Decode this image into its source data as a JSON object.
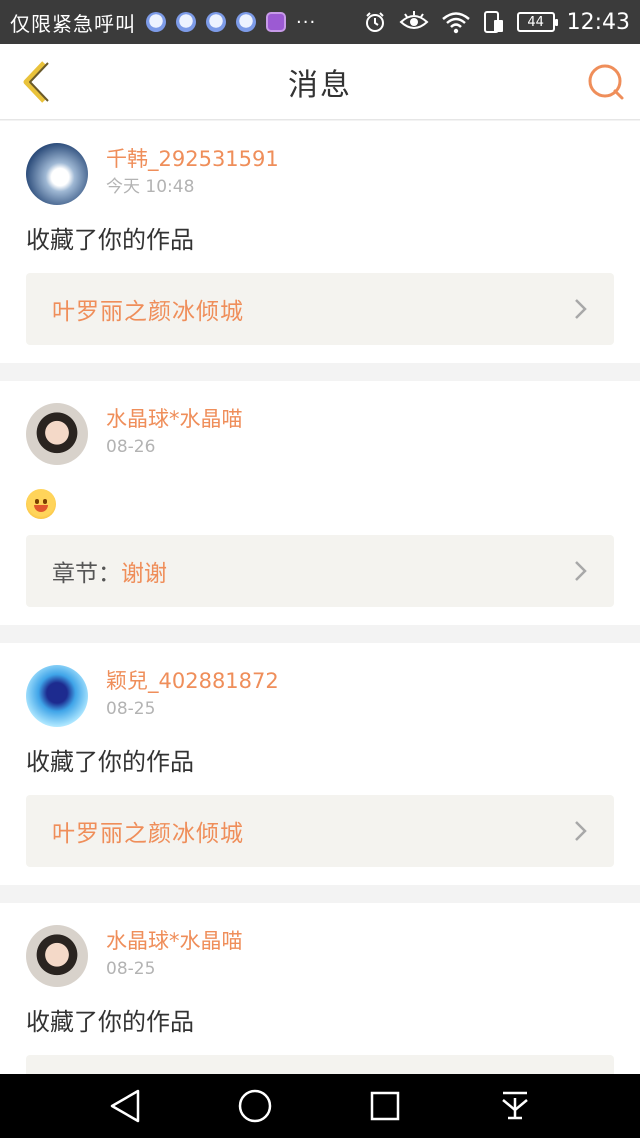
{
  "status_bar": {
    "carrier": "仅限紧急呼叫",
    "more": "···",
    "battery": "44",
    "time": "12:43",
    "icons": [
      "bear-notification-icon",
      "bear-notification-icon",
      "bear-notification-icon",
      "bear-notification-icon",
      "gallery-icon",
      "alarm-icon",
      "eye-icon",
      "wifi-icon",
      "sim-icon",
      "battery-icon"
    ]
  },
  "header": {
    "title": "消息",
    "back_icon": "chevron-left-icon",
    "search_icon": "search-icon"
  },
  "messages": [
    {
      "username": "千韩_292531591",
      "time": "今天 10:48",
      "text": "收藏了你的作品",
      "reference": "叶罗丽之颜冰倾城"
    },
    {
      "username": "水晶球*水晶喵",
      "time": "08-26",
      "emoji": "smile-emoji",
      "reference_label": "章节：",
      "reference_value": "谢谢"
    },
    {
      "username": "颖兒_402881872",
      "time": "08-25",
      "text": "收藏了你的作品",
      "reference": "叶罗丽之颜冰倾城"
    },
    {
      "username": "水晶球*水晶喵",
      "time": "08-25",
      "text": "收藏了你的作品"
    }
  ],
  "colors": {
    "accent": "#ef8e5a",
    "status_bar": "#3b3b3b",
    "card_bg": "#ffffff",
    "reference_bg": "#f4f3ef"
  }
}
